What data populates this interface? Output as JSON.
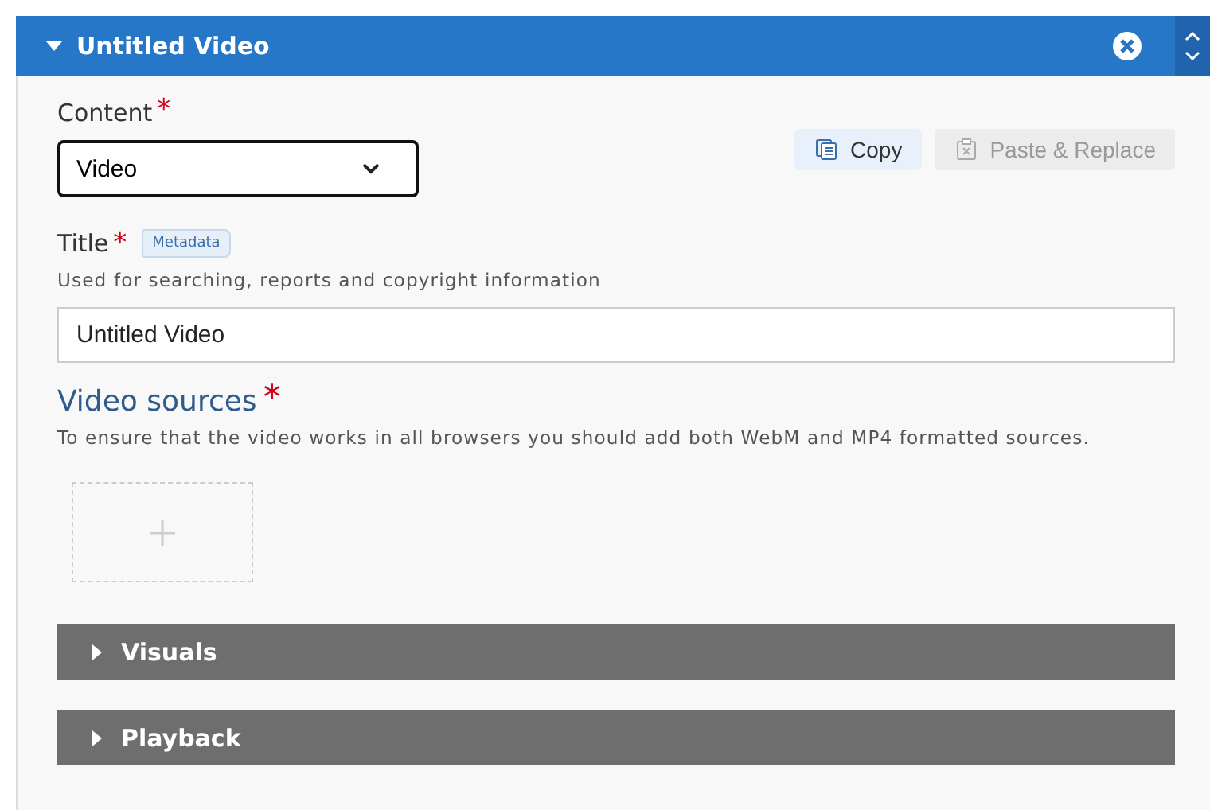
{
  "panel": {
    "title": "Untitled Video",
    "expanded": true
  },
  "content_field": {
    "label": "Content",
    "required_mark": "*",
    "value": "Video"
  },
  "actions": [
    {
      "label": "Copy",
      "disabled": false
    },
    {
      "label": "Paste & Replace",
      "disabled": true
    }
  ],
  "title_field": {
    "label": "Title",
    "required_mark": "*",
    "tag": "Metadata",
    "description": "Used for searching, reports and copyright information",
    "value": "Untitled Video"
  },
  "video_sources": {
    "heading": "Video sources",
    "required_mark": "*",
    "description": "To ensure that the video works in all browsers you should add both WebM and MP4 formatted sources."
  },
  "sections": [
    {
      "label": "Visuals",
      "expanded": false
    },
    {
      "label": "Playback",
      "expanded": false
    }
  ]
}
